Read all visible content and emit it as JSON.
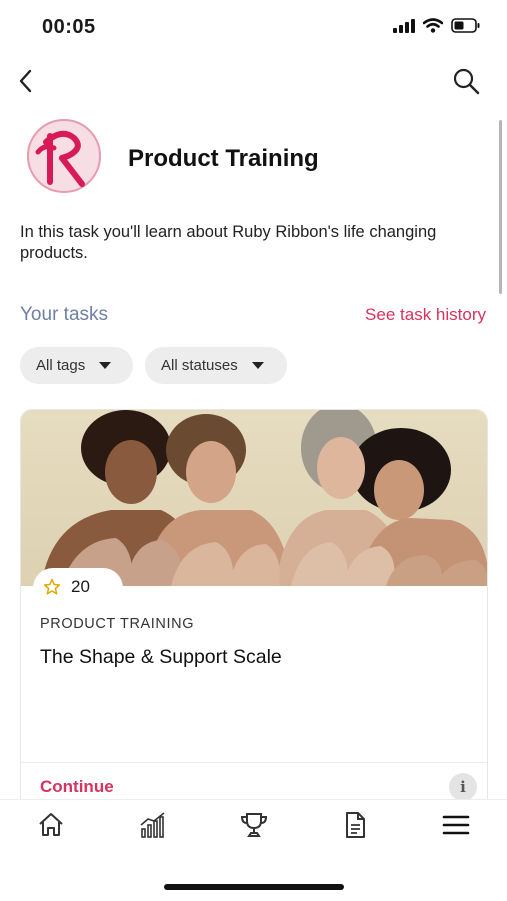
{
  "status_bar": {
    "time": "00:05"
  },
  "header": {
    "back_icon": "chevron-left-icon",
    "search_icon": "search-icon"
  },
  "training": {
    "title": "Product Training",
    "description": "In this task you'll learn about Ruby Ribbon's life changing products."
  },
  "tasks": {
    "label": "Your tasks",
    "history_link": "See task history",
    "filters": [
      {
        "label": "All tags"
      },
      {
        "label": "All statuses"
      }
    ]
  },
  "card": {
    "points": "20",
    "category": "PRODUCT TRAINING",
    "title": "The Shape & Support Scale",
    "action": "Continue",
    "info_label": "i"
  },
  "nav": {
    "items": [
      "home-icon",
      "stats-icon",
      "trophy-icon",
      "document-icon",
      "menu-icon"
    ]
  },
  "colors": {
    "accent": "#d6335e",
    "tasks_label": "#6f7fa6"
  }
}
